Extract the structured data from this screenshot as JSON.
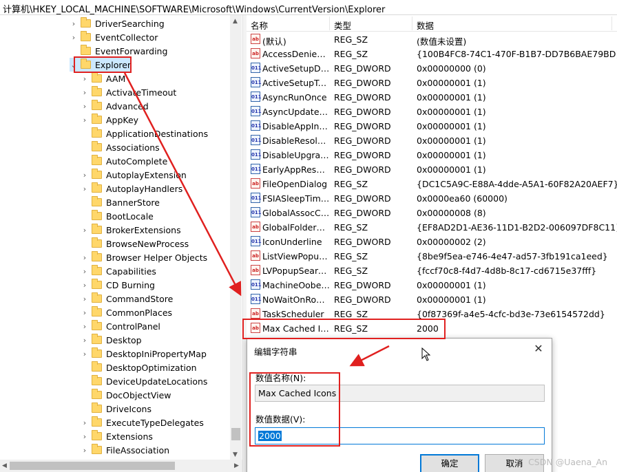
{
  "address_bar": {
    "path": "计算机\\HKEY_LOCAL_MACHINE\\SOFTWARE\\Microsoft\\Windows\\CurrentVersion\\Explorer"
  },
  "tree": {
    "parents": [
      {
        "label": "DriverSearching",
        "expandable": true
      },
      {
        "label": "EventCollector",
        "expandable": true
      },
      {
        "label": "EventForwarding",
        "expandable": false
      },
      {
        "label": "Explorer",
        "expandable": true,
        "expanded": true,
        "selected": true
      }
    ],
    "children": [
      {
        "label": "AAM",
        "expandable": true
      },
      {
        "label": "ActivateTimeout",
        "expandable": true
      },
      {
        "label": "Advanced",
        "expandable": true
      },
      {
        "label": "AppKey",
        "expandable": true
      },
      {
        "label": "ApplicationDestinations",
        "expandable": false
      },
      {
        "label": "Associations",
        "expandable": false
      },
      {
        "label": "AutoComplete",
        "expandable": false
      },
      {
        "label": "AutoplayExtension",
        "expandable": true
      },
      {
        "label": "AutoplayHandlers",
        "expandable": true
      },
      {
        "label": "BannerStore",
        "expandable": false
      },
      {
        "label": "BootLocale",
        "expandable": false
      },
      {
        "label": "BrokerExtensions",
        "expandable": true
      },
      {
        "label": "BrowseNewProcess",
        "expandable": false
      },
      {
        "label": "Browser Helper Objects",
        "expandable": true
      },
      {
        "label": "Capabilities",
        "expandable": true
      },
      {
        "label": "CD Burning",
        "expandable": true
      },
      {
        "label": "CommandStore",
        "expandable": true
      },
      {
        "label": "CommonPlaces",
        "expandable": true
      },
      {
        "label": "ControlPanel",
        "expandable": true
      },
      {
        "label": "Desktop",
        "expandable": true
      },
      {
        "label": "DesktopIniPropertyMap",
        "expandable": true
      },
      {
        "label": "DesktopOptimization",
        "expandable": false
      },
      {
        "label": "DeviceUpdateLocations",
        "expandable": false
      },
      {
        "label": "DocObjectView",
        "expandable": false
      },
      {
        "label": "DriveIcons",
        "expandable": false
      },
      {
        "label": "ExecuteTypeDelegates",
        "expandable": true
      },
      {
        "label": "Extensions",
        "expandable": true
      },
      {
        "label": "FileAssociation",
        "expandable": true
      }
    ]
  },
  "list": {
    "columns": {
      "name": "名称",
      "type": "类型",
      "data": "数据"
    },
    "rows": [
      {
        "icon": "string-value-icon",
        "name": "(默认)",
        "type": "REG_SZ",
        "data": "(数值未设置)"
      },
      {
        "icon": "string-value-icon",
        "name": "AccessDenied…",
        "type": "REG_SZ",
        "data": "{100B4FC8-74C1-470F-B1B7-DD7B6BAE79BD}"
      },
      {
        "icon": "binary-value-icon",
        "name": "ActiveSetupDis…",
        "type": "REG_DWORD",
        "data": "0x00000000 (0)"
      },
      {
        "icon": "binary-value-icon",
        "name": "ActiveSetupTas…",
        "type": "REG_DWORD",
        "data": "0x00000001 (1)"
      },
      {
        "icon": "binary-value-icon",
        "name": "AsyncRunOnce",
        "type": "REG_DWORD",
        "data": "0x00000001 (1)"
      },
      {
        "icon": "binary-value-icon",
        "name": "AsyncUpdateP…",
        "type": "REG_DWORD",
        "data": "0x00000001 (1)"
      },
      {
        "icon": "binary-value-icon",
        "name": "DisableAppIns…",
        "type": "REG_DWORD",
        "data": "0x00000001 (1)"
      },
      {
        "icon": "binary-value-icon",
        "name": "DisableResolv…",
        "type": "REG_DWORD",
        "data": "0x00000001 (1)"
      },
      {
        "icon": "binary-value-icon",
        "name": "DisableUpgra…",
        "type": "REG_DWORD",
        "data": "0x00000001 (1)"
      },
      {
        "icon": "binary-value-icon",
        "name": "EarlyAppResol…",
        "type": "REG_DWORD",
        "data": "0x00000001 (1)"
      },
      {
        "icon": "string-value-icon",
        "name": "FileOpenDialog",
        "type": "REG_SZ",
        "data": "{DC1C5A9C-E88A-4dde-A5A1-60F82A20AEF7}"
      },
      {
        "icon": "binary-value-icon",
        "name": "FSIASleepTime…",
        "type": "REG_DWORD",
        "data": "0x0000ea60 (60000)"
      },
      {
        "icon": "binary-value-icon",
        "name": "GlobalAssocCh…",
        "type": "REG_DWORD",
        "data": "0x00000008 (8)"
      },
      {
        "icon": "string-value-icon",
        "name": "GlobalFolderS…",
        "type": "REG_SZ",
        "data": "{EF8AD2D1-AE36-11D1-B2D2-006097DF8C11}"
      },
      {
        "icon": "binary-value-icon",
        "name": "IconUnderline",
        "type": "REG_DWORD",
        "data": "0x00000002 (2)"
      },
      {
        "icon": "string-value-icon",
        "name": "ListViewPopup…",
        "type": "REG_SZ",
        "data": "{8be9f5ea-e746-4e47-ad57-3fb191ca1eed}"
      },
      {
        "icon": "string-value-icon",
        "name": "LVPopupSearc…",
        "type": "REG_SZ",
        "data": "{fccf70c8-f4d7-4d8b-8c17-cd6715e37fff}"
      },
      {
        "icon": "binary-value-icon",
        "name": "MachineOobe…",
        "type": "REG_DWORD",
        "data": "0x00000001 (1)"
      },
      {
        "icon": "binary-value-icon",
        "name": "NoWaitOnRoa…",
        "type": "REG_DWORD",
        "data": "0x00000001 (1)"
      },
      {
        "icon": "string-value-icon",
        "name": "TaskScheduler",
        "type": "REG_SZ",
        "data": "{0f87369f-a4e5-4cfc-bd3e-73e6154572dd}"
      },
      {
        "icon": "string-value-icon",
        "name": "Max Cached Ic…",
        "type": "REG_SZ",
        "data": "2000"
      }
    ]
  },
  "dialog": {
    "title": "编辑字符串",
    "close_glyph": "✕",
    "name_label": "数值名称(N):",
    "name_value": "Max Cached Icons",
    "data_label": "数值数据(V):",
    "data_value": "2000",
    "ok_label": "确定",
    "cancel_label": "取消"
  },
  "watermark": "CSDN @Uaena_An",
  "annotation_color": "#e0201f"
}
